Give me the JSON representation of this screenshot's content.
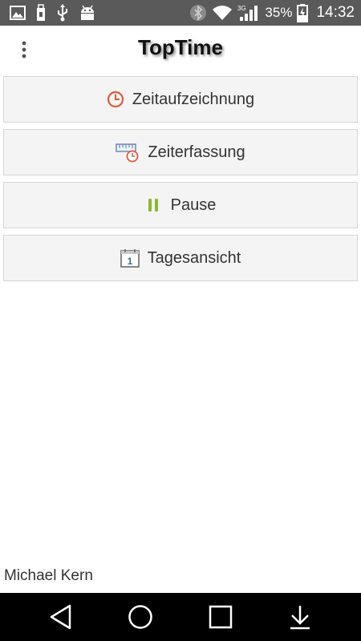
{
  "status_bar": {
    "left_icons": [
      "gallery-icon",
      "usb-storage-icon",
      "usb-icon",
      "android-debug-icon"
    ],
    "right_icons": [
      "bluetooth-icon",
      "wifi-icon",
      "network-3g-icon",
      "battery-charging-icon"
    ],
    "network_type": "3G",
    "battery_percent": "35%",
    "time": "14:32"
  },
  "app_bar": {
    "title": "TopTime",
    "menu_icon": "overflow-menu-icon"
  },
  "menu": {
    "items": [
      {
        "label": "Zeitaufzeichnung",
        "icon": "clock-icon"
      },
      {
        "label": "Zeiterfassung",
        "icon": "ruler-clock-icon"
      },
      {
        "label": "Pause",
        "icon": "pause-icon"
      },
      {
        "label": "Tagesansicht",
        "icon": "calendar-icon",
        "icon_text": "1"
      }
    ]
  },
  "footer": {
    "user_name": "Michael Kern"
  },
  "nav_bar": {
    "buttons": [
      "back",
      "home",
      "recents",
      "notifications-down"
    ]
  },
  "colors": {
    "status_bar": "#5a5a5a",
    "button_bg": "#f4f4f4",
    "button_border": "#d6d6d6",
    "accent_clock": "#e05a3a",
    "pause_green": "#8ab82e",
    "calendar_blue": "#3a6ea8",
    "nav_bar": "#000000"
  }
}
